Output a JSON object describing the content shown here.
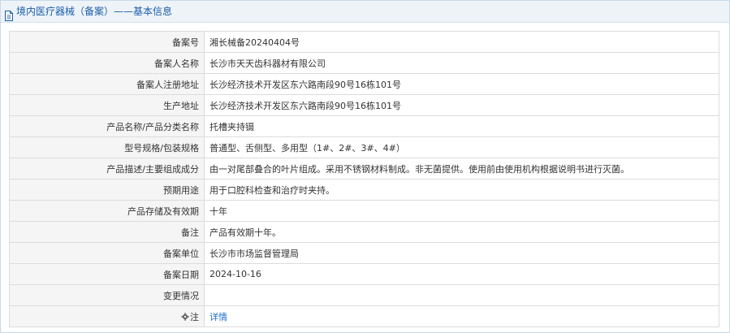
{
  "header": {
    "title": "境内医疗器械（备案）——基本信息",
    "icon": "document-icon"
  },
  "rows": [
    {
      "label": "备案号",
      "value": "湘长械备20240404号"
    },
    {
      "label": "备案人名称",
      "value": "长沙市天天齿科器材有限公司"
    },
    {
      "label": "备案人注册地址",
      "value": "长沙经济技术开发区东六路南段90号16栋101号"
    },
    {
      "label": "生产地址",
      "value": "长沙经济技术开发区东六路南段90号16栋101号"
    },
    {
      "label": "产品名称/产品分类名称",
      "value": "托槽夹持镊"
    },
    {
      "label": "型号规格/包装规格",
      "value": "普通型、舌侧型、多用型（1#、2#、3#、4#）"
    },
    {
      "label": "产品描述/主要组成成分",
      "value": "由一对尾部叠合的叶片组成。采用不锈钢材料制成。非无菌提供。使用前由使用机构根据说明书进行灭菌。"
    },
    {
      "label": "预期用途",
      "value": "用于口腔科检查和治疗时夹持。"
    },
    {
      "label": "产品存储及有效期",
      "value": "十年"
    },
    {
      "label": "备注",
      "value": "产品有效期十年。"
    },
    {
      "label": "备案单位",
      "value": "长沙市市场监督管理局"
    },
    {
      "label": "备案日期",
      "value": "2024-10-16"
    },
    {
      "label": "变更情况",
      "value": ""
    }
  ],
  "note_row": {
    "label": "注",
    "link_text": "详情",
    "icon": "gear-icon"
  },
  "colors": {
    "header_text": "#1a5fa8",
    "header_bg": "#eef3f8",
    "label_bg": "#f5f5f5",
    "border": "#dcdcdc",
    "link": "#1a6ec7"
  }
}
